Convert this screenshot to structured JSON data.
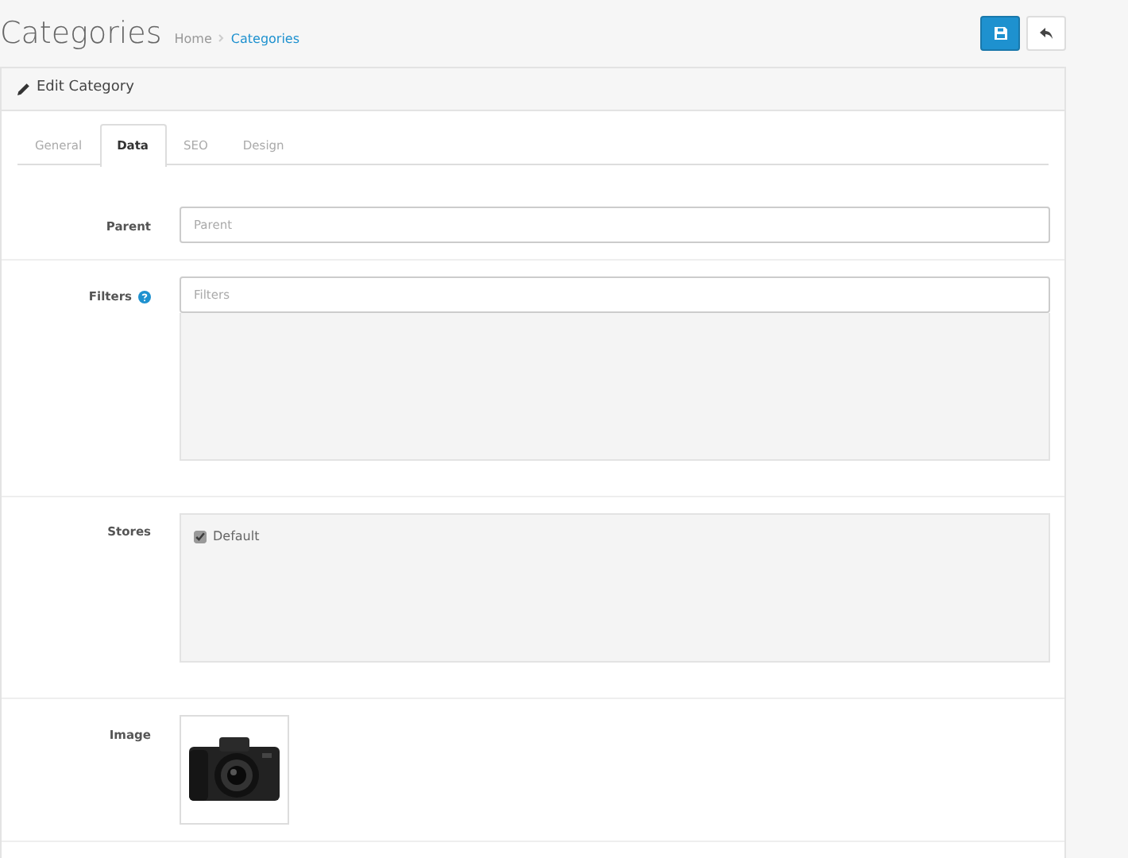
{
  "page": {
    "title": "Categories",
    "breadcrumb": [
      {
        "label": "Home",
        "selected": false
      },
      {
        "label": "Categories",
        "selected": true
      }
    ]
  },
  "header_buttons": [
    {
      "kind": "save"
    },
    {
      "kind": "back"
    }
  ],
  "panel": {
    "title": "Edit Category"
  },
  "tabs": [
    {
      "label": "General",
      "selected": false
    },
    {
      "label": "Data",
      "selected": true
    },
    {
      "label": "SEO",
      "selected": false
    },
    {
      "label": "Design",
      "selected": false
    }
  ],
  "fields": [
    {
      "kind": "input",
      "label": "Parent",
      "placeholder": "Parent"
    },
    {
      "kind": "autocomplete",
      "label": "Filters",
      "help": true,
      "placeholder": "Filters"
    },
    {
      "kind": "checklist",
      "label": "Stores",
      "options": [
        {
          "label": "Default",
          "checked": true
        }
      ]
    },
    {
      "label": "Image"
    }
  ]
}
